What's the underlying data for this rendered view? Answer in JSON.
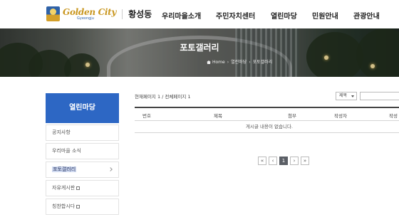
{
  "header": {
    "logo_main": "Golden City",
    "logo_sub": "Gyeongju",
    "district": "황성동",
    "nav": [
      "우리마을소개",
      "주민자치센터",
      "열린마당",
      "민원안내",
      "관광안내"
    ]
  },
  "banner": {
    "title": "포토갤러리",
    "breadcrumb": [
      "Home",
      "열린마당",
      "포토갤러리"
    ]
  },
  "sidebar": {
    "title": "열린마당",
    "items": [
      {
        "label": "공지사항"
      },
      {
        "label": "우리마을 소식"
      },
      {
        "label": "포토갤러리"
      },
      {
        "label": "자유게시판"
      },
      {
        "label": "칭찬합시다"
      }
    ]
  },
  "main": {
    "page_info": "현재페이지 1 / 전체페이지 1",
    "search_select": "제목",
    "columns": [
      "번호",
      "제목",
      "첨부",
      "작성자",
      "작성"
    ],
    "empty_message": "게시글 내용이 없습니다.",
    "pagination": {
      "first": "«",
      "prev": "‹",
      "current": "1",
      "next": "›",
      "last": "»"
    }
  },
  "colors": {
    "accent_blue": "#2d67c4",
    "logo_gold": "#c9961e",
    "pager_current": "#5b5f66"
  }
}
